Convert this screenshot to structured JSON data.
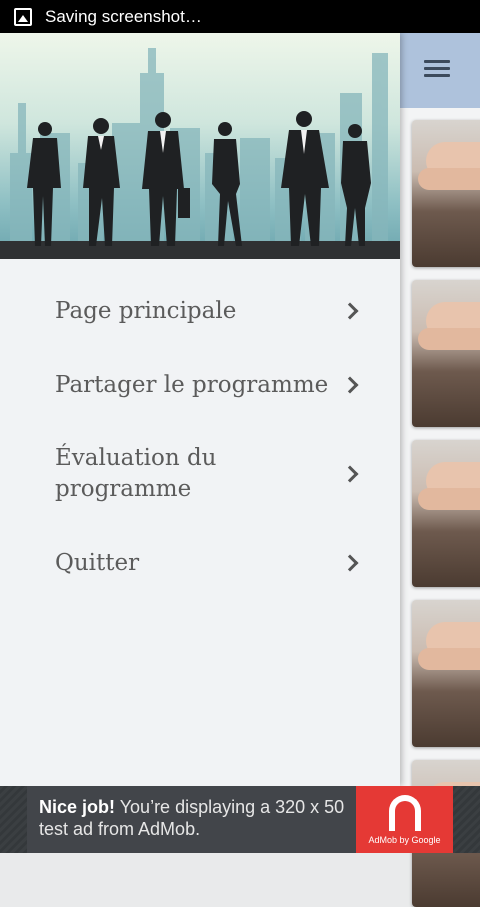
{
  "status_bar": {
    "text": "Saving screenshot…",
    "icon": "screenshot-icon"
  },
  "drawer": {
    "menu": [
      {
        "label": "Page principale"
      },
      {
        "label": "Partager le programme"
      },
      {
        "label": "Évaluation du programme"
      },
      {
        "label": "Quitter"
      }
    ]
  },
  "header": {
    "menu_icon": "hamburger-menu-icon"
  },
  "ad": {
    "headline": "Nice job!",
    "body": " You’re displaying a 320 x 50 test ad from AdMob.",
    "caption": "AdMob by Google",
    "brand_color": "#e53935"
  },
  "colors": {
    "header_bg": "#aec2dc",
    "drawer_bg": "#f1f3f5",
    "status_bar": "#000000"
  }
}
